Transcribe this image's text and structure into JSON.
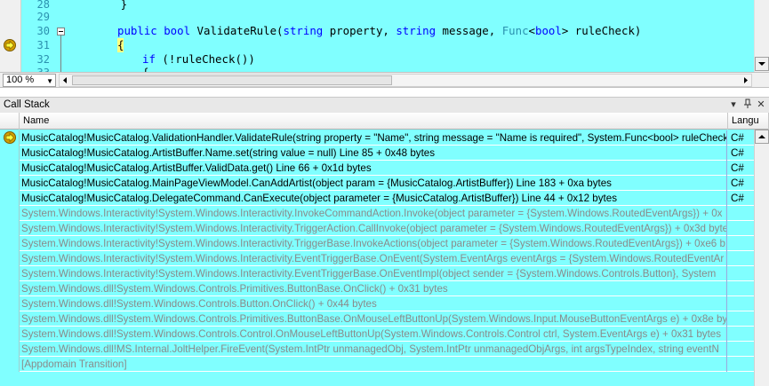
{
  "editor": {
    "lines": [
      {
        "num": "28",
        "code": "        }"
      },
      {
        "num": "29",
        "code": ""
      },
      {
        "num": "30",
        "code_kw1": "public bool",
        "code_name": " ValidateRule(",
        "code_kw2": "string",
        "code_p1": " property, ",
        "code_kw3": "string",
        "code_p2": " message, ",
        "code_ty": "Func",
        "code_p3": "<",
        "code_kw4": "bool",
        "code_p4": "> ruleCheck)"
      },
      {
        "num": "31",
        "code": "{"
      },
      {
        "num": "32",
        "code_kw": "if",
        "code_rest": " (!ruleCheck())"
      },
      {
        "num": "33",
        "code": "{"
      }
    ]
  },
  "zoom": {
    "value": "100 %"
  },
  "callstack": {
    "title": "Call Stack",
    "columns": {
      "name": "Name",
      "language": "Langu"
    },
    "rows": [
      {
        "name": "MusicCatalog!MusicCatalog.ValidationHandler.ValidateRule(string property = \"Name\", string message = \"Name is required\", System.Func<bool> ruleCheck",
        "lang": "C#",
        "current": true,
        "external": false
      },
      {
        "name": "MusicCatalog!MusicCatalog.ArtistBuffer.Name.set(string value = null) Line 85 + 0x48 bytes",
        "lang": "C#",
        "current": false,
        "external": false
      },
      {
        "name": "MusicCatalog!MusicCatalog.ArtistBuffer.ValidData.get() Line 66 + 0x1d bytes",
        "lang": "C#",
        "current": false,
        "external": false
      },
      {
        "name": "MusicCatalog!MusicCatalog.MainPageViewModel.CanAddArtist(object param = {MusicCatalog.ArtistBuffer}) Line 183 + 0xa bytes",
        "lang": "C#",
        "current": false,
        "external": false
      },
      {
        "name": "MusicCatalog!MusicCatalog.DelegateCommand.CanExecute(object parameter = {MusicCatalog.ArtistBuffer}) Line 44 + 0x12 bytes",
        "lang": "C#",
        "current": false,
        "external": false
      },
      {
        "name": "System.Windows.Interactivity!System.Windows.Interactivity.InvokeCommandAction.Invoke(object parameter = {System.Windows.RoutedEventArgs}) + 0x",
        "lang": "",
        "current": false,
        "external": true
      },
      {
        "name": "System.Windows.Interactivity!System.Windows.Interactivity.TriggerAction.CallInvoke(object parameter = {System.Windows.RoutedEventArgs}) + 0x3d byte",
        "lang": "",
        "current": false,
        "external": true
      },
      {
        "name": "System.Windows.Interactivity!System.Windows.Interactivity.TriggerBase.InvokeActions(object parameter = {System.Windows.RoutedEventArgs}) + 0xe6 b",
        "lang": "",
        "current": false,
        "external": true
      },
      {
        "name": "System.Windows.Interactivity!System.Windows.Interactivity.EventTriggerBase.OnEvent(System.EventArgs eventArgs = {System.Windows.RoutedEventAr",
        "lang": "",
        "current": false,
        "external": true
      },
      {
        "name": "System.Windows.Interactivity!System.Windows.Interactivity.EventTriggerBase.OnEventImpl(object sender = {System.Windows.Controls.Button}, System",
        "lang": "",
        "current": false,
        "external": true
      },
      {
        "name": "System.Windows.dll!System.Windows.Controls.Primitives.ButtonBase.OnClick() + 0x31 bytes",
        "lang": "",
        "current": false,
        "external": true
      },
      {
        "name": "System.Windows.dll!System.Windows.Controls.Button.OnClick() + 0x44 bytes",
        "lang": "",
        "current": false,
        "external": true
      },
      {
        "name": "System.Windows.dll!System.Windows.Controls.Primitives.ButtonBase.OnMouseLeftButtonUp(System.Windows.Input.MouseButtonEventArgs e) + 0x8e by",
        "lang": "",
        "current": false,
        "external": true
      },
      {
        "name": "System.Windows.dll!System.Windows.Controls.Control.OnMouseLeftButtonUp(System.Windows.Controls.Control ctrl, System.EventArgs e) + 0x31 bytes",
        "lang": "",
        "current": false,
        "external": true
      },
      {
        "name": "System.Windows.dll!MS.Internal.JoltHelper.FireEvent(System.IntPtr unmanagedObj, System.IntPtr unmanagedObjArgs, int argsTypeIndex, string eventN",
        "lang": "",
        "current": false,
        "external": true
      },
      {
        "name": "[Appdomain Transition]",
        "lang": "",
        "current": false,
        "external": true
      }
    ]
  },
  "colors": {
    "highlight_bg": "#80ffff",
    "external_text": "#8a8a8a",
    "keyword": "#0000ff",
    "type": "#2b91af"
  },
  "icons": [
    "current-statement-arrow-icon",
    "dropdown-arrow-icon",
    "pin-icon",
    "close-icon",
    "scroll-up-icon",
    "scroll-down-icon",
    "scroll-left-icon",
    "scroll-right-icon"
  ]
}
